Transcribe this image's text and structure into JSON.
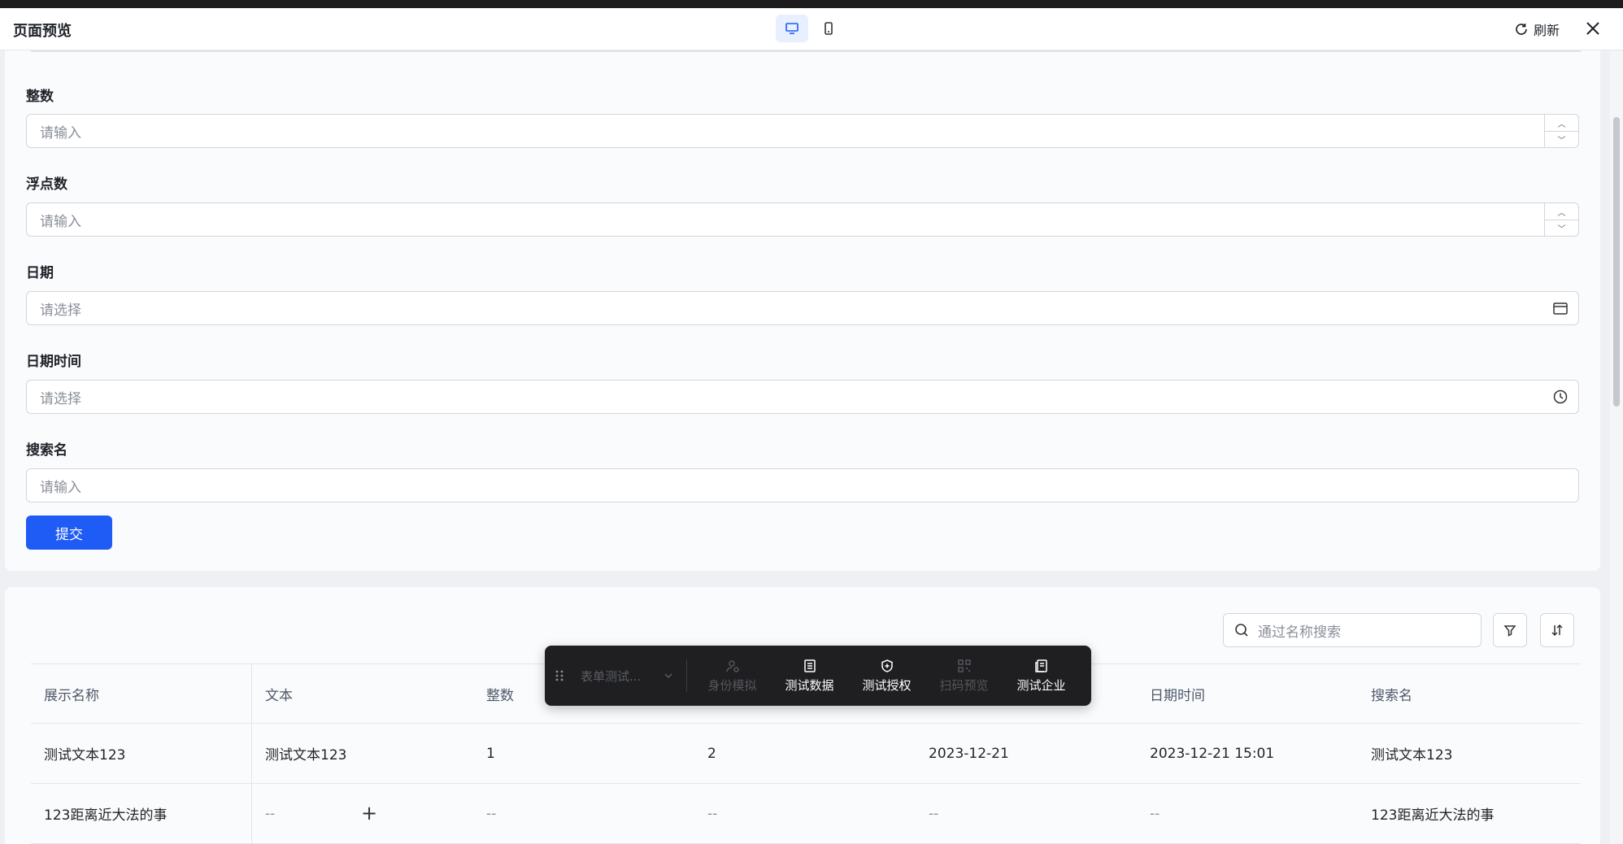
{
  "header": {
    "title": "页面预览",
    "refresh_label": "刷新"
  },
  "form": {
    "fields": [
      {
        "label": "整数",
        "placeholder": "请输入"
      },
      {
        "label": "浮点数",
        "placeholder": "请输入"
      },
      {
        "label": "日期",
        "placeholder": "请选择"
      },
      {
        "label": "日期时间",
        "placeholder": "请选择"
      },
      {
        "label": "搜索名",
        "placeholder": "请输入"
      }
    ],
    "submit_label": "提交"
  },
  "table": {
    "search_placeholder": "通过名称搜索",
    "columns": [
      "展示名称",
      "文本",
      "整数",
      "",
      "",
      "日期时间",
      "搜索名"
    ],
    "rows": [
      [
        "测试文本123",
        "测试文本123",
        "1",
        "2",
        "2023-12-21",
        "2023-12-21 15:01",
        "测试文本123"
      ],
      [
        "123距离近大法的事",
        "--",
        "--",
        "--",
        "--",
        "--",
        "123距离近大法的事"
      ]
    ]
  },
  "toolbar": {
    "select_label": "表单测试...",
    "items": [
      {
        "label": "身份模拟",
        "icon": "user-switch-icon",
        "enabled": false
      },
      {
        "label": "测试数据",
        "icon": "list-icon",
        "enabled": true
      },
      {
        "label": "测试授权",
        "icon": "shield-icon",
        "enabled": true
      },
      {
        "label": "扫码预览",
        "icon": "qrcode-icon",
        "enabled": false
      },
      {
        "label": "测试企业",
        "icon": "enterprise-icon",
        "enabled": true
      }
    ]
  },
  "colors": {
    "primary": "#1f5bf5",
    "toolbar_bg": "#1f1f22"
  }
}
